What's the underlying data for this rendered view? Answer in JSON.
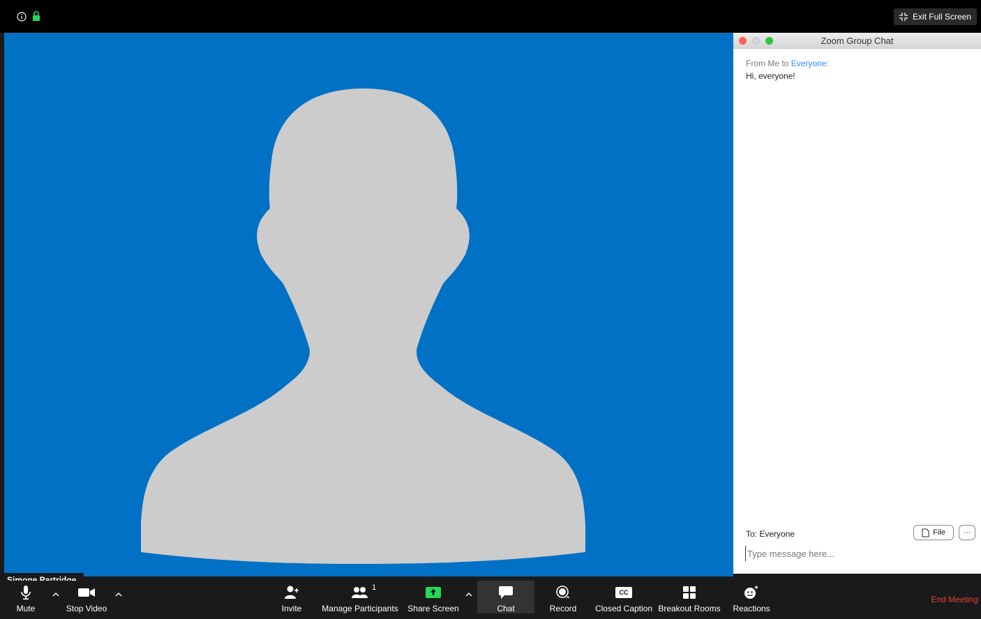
{
  "top_bar": {
    "exit_fullscreen_label": "Exit Full Screen"
  },
  "video": {
    "participant_name": "Simone Partridge",
    "background_color": "#0071c4"
  },
  "chat": {
    "window_title": "Zoom Group Chat",
    "messages": [
      {
        "from": "From Me to ",
        "to": "Everyone",
        "suffix": ":",
        "text": "Hi, everyone!"
      }
    ],
    "recipient_label": "To: Everyone",
    "file_button_label": "File",
    "more_button_label": "···",
    "input_placeholder": "Type message here..."
  },
  "toolbar": {
    "mute_label": "Mute",
    "stop_video_label": "Stop Video",
    "invite_label": "Invite",
    "manage_participants_label": "Manage Participants",
    "participant_count": "1",
    "share_screen_label": "Share Screen",
    "chat_label": "Chat",
    "record_label": "Record",
    "closed_caption_label": "Closed Caption",
    "cc_icon_text": "CC",
    "breakout_rooms_label": "Breakout Rooms",
    "reactions_label": "Reactions",
    "end_meeting_label": "End Meeting"
  },
  "colors": {
    "end_meeting": "#e8413a",
    "share_screen": "#23d959",
    "chat_recipient": "#2d8cff",
    "lock_icon": "#23d959"
  }
}
